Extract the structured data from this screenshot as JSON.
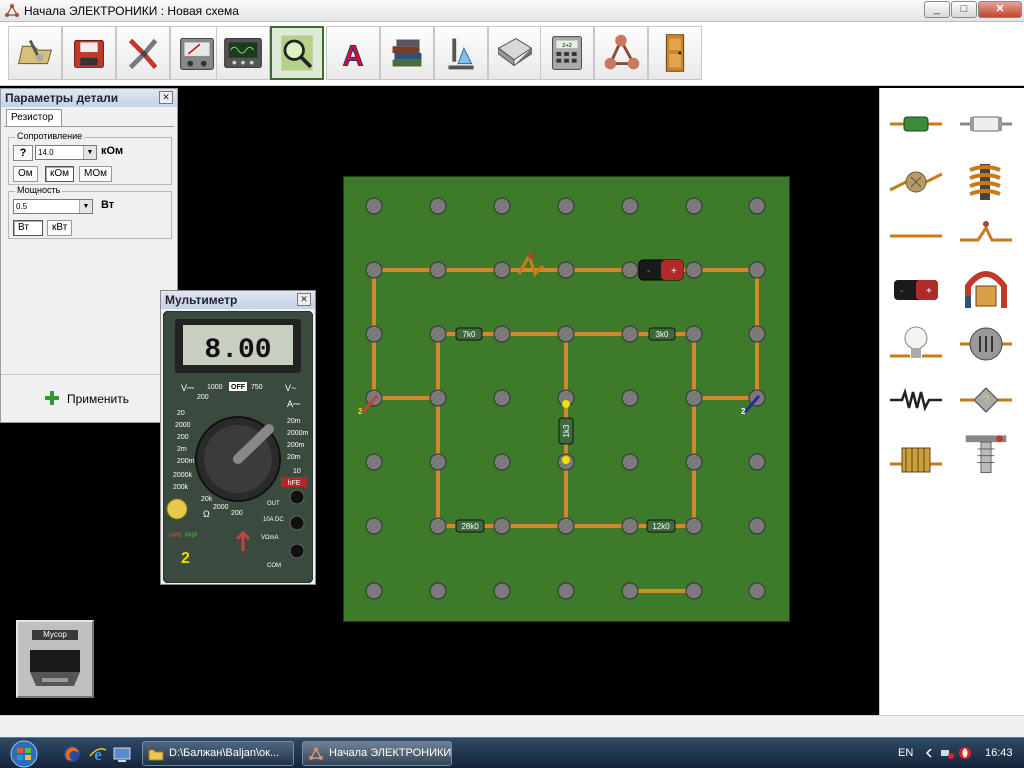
{
  "window": {
    "title": "Начала ЭЛЕКТРОНИКИ : Новая схема",
    "minimize": "_",
    "maximize": "□",
    "close": "✕"
  },
  "toolbar": {
    "items": [
      {
        "name": "open",
        "icon": "open-folder-icon"
      },
      {
        "name": "save",
        "icon": "floppy-save-icon"
      },
      {
        "name": "tools",
        "icon": "pliers-icon"
      },
      {
        "name": "meter",
        "icon": "analog-meter-icon"
      },
      {
        "name": "oscilloscope",
        "icon": "oscilloscope-icon"
      },
      {
        "name": "inspect",
        "icon": "magnifier-circuit-icon"
      },
      {
        "name": "text",
        "icon": "letter-a-icon",
        "label": "A"
      },
      {
        "name": "books",
        "icon": "books-icon"
      },
      {
        "name": "lab",
        "icon": "microscope-icon"
      },
      {
        "name": "keyboard",
        "icon": "key-icon"
      },
      {
        "name": "calculator",
        "icon": "calculator-icon",
        "label": "2+2"
      },
      {
        "name": "molecule",
        "icon": "molecule-icon"
      },
      {
        "name": "exit",
        "icon": "door-exit-icon"
      }
    ]
  },
  "properties": {
    "title": "Параметры детали",
    "close": "✕",
    "tab": "Резистор",
    "resistance": {
      "label": "Сопротивление",
      "help": "?",
      "value": "14.0",
      "unit": "кОм",
      "units": [
        "Ом",
        "кОм",
        "МОм"
      ],
      "selected": "кОм"
    },
    "power": {
      "label": "Мощность",
      "value": "0.5",
      "unit": "Вт",
      "units": [
        "Вт",
        "кВт"
      ],
      "selected": "Вт"
    },
    "apply": "Применить"
  },
  "multimeter": {
    "title": "Мультиметр",
    "close": "✕",
    "display": "8.00",
    "dial_labels": [
      "V⎓",
      "1000",
      "OFF",
      "750",
      "V~",
      "200",
      "A⎓",
      "20",
      "2000",
      "20m",
      "200",
      "2000m",
      "200m",
      "2m",
      "20m",
      "200m",
      "2000k",
      "10",
      "200k",
      "20k",
      "2000",
      "hFE",
      "200",
      "10A DC",
      "VΩmA",
      "COM",
      "OUT",
      "Ω",
      "NPN",
      "PNP"
    ],
    "socket_number": "2"
  },
  "board": {
    "resistors": [
      "7k0",
      "3k0",
      "1k3",
      "28k0",
      "12k0"
    ],
    "probe_labels": [
      "2",
      "2"
    ]
  },
  "palette": {
    "items": [
      "resistor-icon",
      "fuse-icon",
      "potentiometer-icon",
      "inductor-icon",
      "wire-icon",
      "switch-icon",
      "battery-icon",
      "motor-icon",
      "lamp-icon",
      "ammeter-icon",
      "coil-icon",
      "variable-resistor-icon",
      "solenoid-icon",
      "relay-icon"
    ]
  },
  "trash": {
    "label": "Мусор"
  },
  "taskbar": {
    "tasks": [
      "D:\\Балжан\\Baljan\\ок...",
      "Начала ЭЛЕКТРОНИКИ"
    ],
    "lang": "EN",
    "clock": "16:43"
  },
  "colors": {
    "board": "#3d7a2a",
    "wire": "#d08a2a",
    "toolbar_active": "#3c6e2a"
  }
}
